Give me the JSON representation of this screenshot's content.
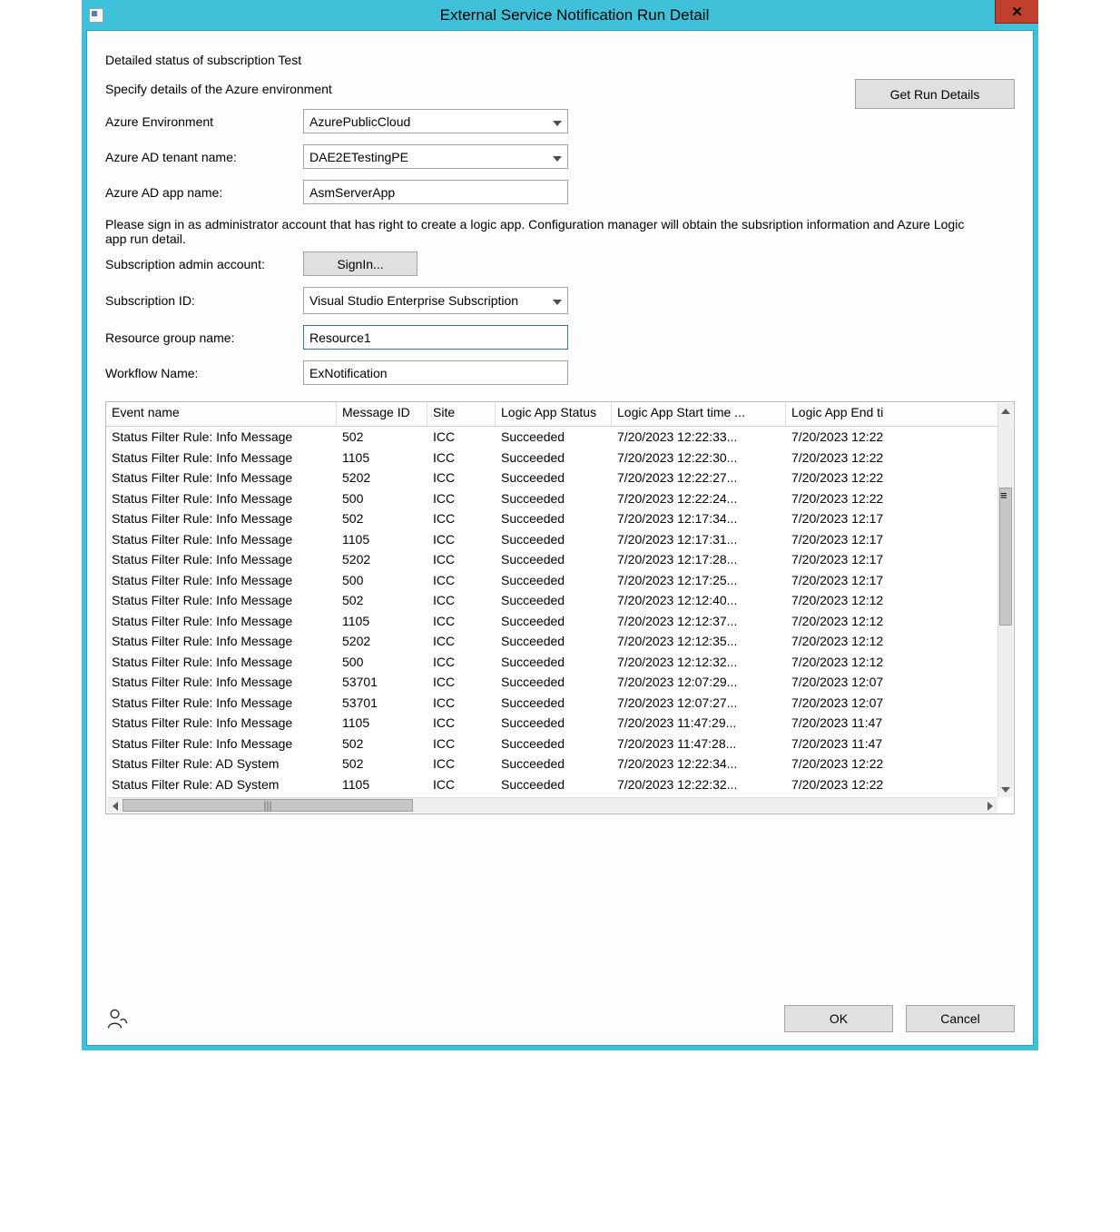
{
  "window": {
    "title": "External Service Notification Run Detail"
  },
  "header": {
    "status_heading": "Detailed status of subscription Test",
    "specify_env": "Specify details of the Azure environment",
    "get_run_details": "Get Run Details"
  },
  "form": {
    "azure_env_label": "Azure Environment",
    "azure_env_value": "AzurePublicCloud",
    "tenant_label": "Azure AD tenant name:",
    "tenant_value": "DAE2ETestingPE",
    "app_label": "Azure AD app name:",
    "app_value": "AsmServerApp",
    "instruction": "Please sign in as administrator account that has right to create a logic app. Configuration manager will obtain the subsription information and Azure Logic app run detail.",
    "admin_label": "Subscription admin account:",
    "signin_label": "SignIn...",
    "sub_id_label": "Subscription ID:",
    "sub_id_value": "Visual Studio Enterprise Subscription",
    "rg_label": "Resource group name:",
    "rg_value": "Resource1",
    "workflow_label": "Workflow Name:",
    "workflow_value": "ExNotification"
  },
  "grid": {
    "columns": {
      "event": "Event name",
      "msg": "Message ID",
      "site": "Site",
      "status": "Logic App Status",
      "start": "Logic App Start time ...",
      "end": "Logic App End ti"
    },
    "rows": [
      {
        "event": "Status Filter Rule: Info Message",
        "msg": "502",
        "site": "ICC",
        "status": "Succeeded",
        "start": "7/20/2023 12:22:33...",
        "end": "7/20/2023 12:22"
      },
      {
        "event": "Status Filter Rule: Info Message",
        "msg": "1105",
        "site": "ICC",
        "status": "Succeeded",
        "start": "7/20/2023 12:22:30...",
        "end": "7/20/2023 12:22"
      },
      {
        "event": "Status Filter Rule: Info Message",
        "msg": "5202",
        "site": "ICC",
        "status": "Succeeded",
        "start": "7/20/2023 12:22:27...",
        "end": "7/20/2023 12:22"
      },
      {
        "event": "Status Filter Rule: Info Message",
        "msg": "500",
        "site": "ICC",
        "status": "Succeeded",
        "start": "7/20/2023 12:22:24...",
        "end": "7/20/2023 12:22"
      },
      {
        "event": "Status Filter Rule: Info Message",
        "msg": "502",
        "site": "ICC",
        "status": "Succeeded",
        "start": "7/20/2023 12:17:34...",
        "end": "7/20/2023 12:17"
      },
      {
        "event": "Status Filter Rule: Info Message",
        "msg": "1105",
        "site": "ICC",
        "status": "Succeeded",
        "start": "7/20/2023 12:17:31...",
        "end": "7/20/2023 12:17"
      },
      {
        "event": "Status Filter Rule: Info Message",
        "msg": "5202",
        "site": "ICC",
        "status": "Succeeded",
        "start": "7/20/2023 12:17:28...",
        "end": "7/20/2023 12:17"
      },
      {
        "event": "Status Filter Rule: Info Message",
        "msg": "500",
        "site": "ICC",
        "status": "Succeeded",
        "start": "7/20/2023 12:17:25...",
        "end": "7/20/2023 12:17"
      },
      {
        "event": "Status Filter Rule: Info Message",
        "msg": "502",
        "site": "ICC",
        "status": "Succeeded",
        "start": "7/20/2023 12:12:40...",
        "end": "7/20/2023 12:12"
      },
      {
        "event": "Status Filter Rule: Info Message",
        "msg": "1105",
        "site": "ICC",
        "status": "Succeeded",
        "start": "7/20/2023 12:12:37...",
        "end": "7/20/2023 12:12"
      },
      {
        "event": "Status Filter Rule: Info Message",
        "msg": "5202",
        "site": "ICC",
        "status": "Succeeded",
        "start": "7/20/2023 12:12:35...",
        "end": "7/20/2023 12:12"
      },
      {
        "event": "Status Filter Rule: Info Message",
        "msg": "500",
        "site": "ICC",
        "status": "Succeeded",
        "start": "7/20/2023 12:12:32...",
        "end": "7/20/2023 12:12"
      },
      {
        "event": "Status Filter Rule: Info Message",
        "msg": "53701",
        "site": "ICC",
        "status": "Succeeded",
        "start": "7/20/2023 12:07:29...",
        "end": "7/20/2023 12:07"
      },
      {
        "event": "Status Filter Rule: Info Message",
        "msg": "53701",
        "site": "ICC",
        "status": "Succeeded",
        "start": "7/20/2023 12:07:27...",
        "end": "7/20/2023 12:07"
      },
      {
        "event": "Status Filter Rule: Info Message",
        "msg": "1105",
        "site": "ICC",
        "status": "Succeeded",
        "start": "7/20/2023 11:47:29...",
        "end": "7/20/2023 11:47"
      },
      {
        "event": "Status Filter Rule: Info Message",
        "msg": "502",
        "site": "ICC",
        "status": "Succeeded",
        "start": "7/20/2023 11:47:28...",
        "end": "7/20/2023 11:47"
      },
      {
        "event": "Status Filter Rule: AD System",
        "msg": "502",
        "site": "ICC",
        "status": "Succeeded",
        "start": "7/20/2023 12:22:34...",
        "end": "7/20/2023 12:22"
      },
      {
        "event": "Status Filter Rule: AD System",
        "msg": "1105",
        "site": "ICC",
        "status": "Succeeded",
        "start": "7/20/2023 12:22:32...",
        "end": "7/20/2023 12:22"
      }
    ]
  },
  "footer": {
    "ok": "OK",
    "cancel": "Cancel"
  }
}
